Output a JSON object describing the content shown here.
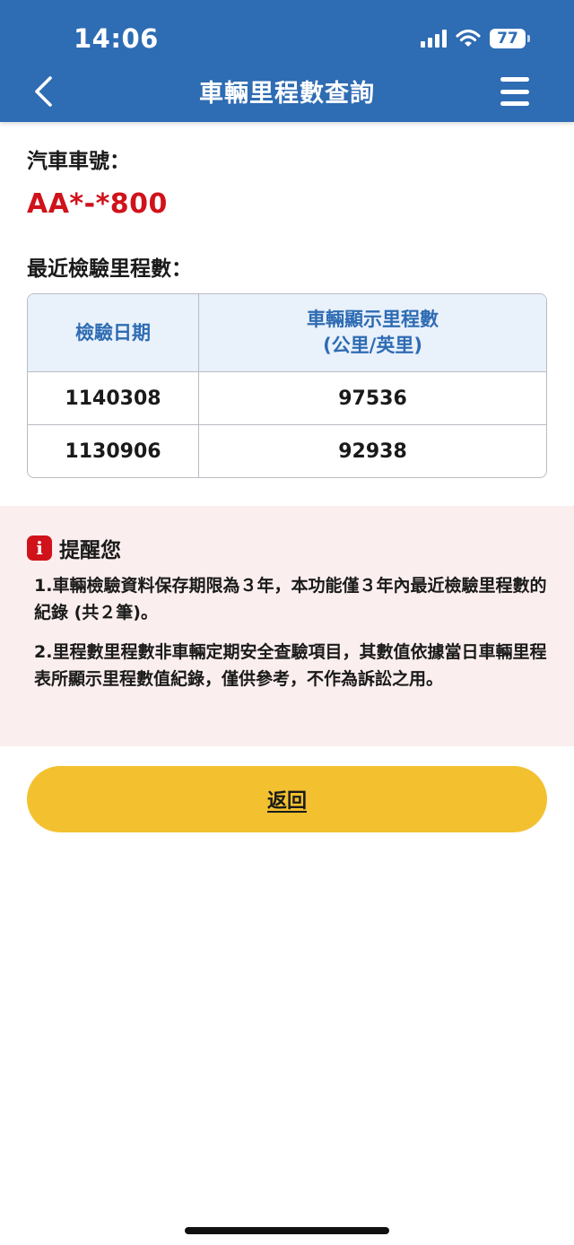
{
  "status_bar": {
    "time": "14:06",
    "battery": "77"
  },
  "header": {
    "title": "車輛里程數查詢"
  },
  "vehicle": {
    "plate_label": "汽車車號：",
    "plate_value": "AA*-*800"
  },
  "mileage": {
    "section_label": "最近檢驗里程數：",
    "columns": {
      "date": "檢驗日期",
      "mileage_line1": "車輛顯示里程數",
      "mileage_line2": "(公里/英里)"
    },
    "rows": [
      {
        "date": "1140308",
        "mileage": "97536"
      },
      {
        "date": "1130906",
        "mileage": "92938"
      }
    ]
  },
  "notice": {
    "title": "提醒您",
    "items": [
      "1.車輛檢驗資料保存期限為３年，本功能僅３年內最近檢驗里程數的紀錄 (共２筆)。",
      "2.里程數里程數非車輛定期安全查驗項目，其數值依據當日車輛里程表所顯示里程數值紀錄，僅供參考，不作為訴訟之用。"
    ]
  },
  "actions": {
    "back_label": "返回"
  },
  "colors": {
    "header": "#2e6cb3",
    "plate": "#d0121b",
    "table_header_bg": "#e9f1fb",
    "notice_bg": "#fbeeee",
    "button": "#f3c12f"
  },
  "icons": [
    "signal-icon",
    "wifi-icon",
    "battery-icon",
    "back-chevron-icon",
    "menu-icon",
    "info-icon"
  ]
}
